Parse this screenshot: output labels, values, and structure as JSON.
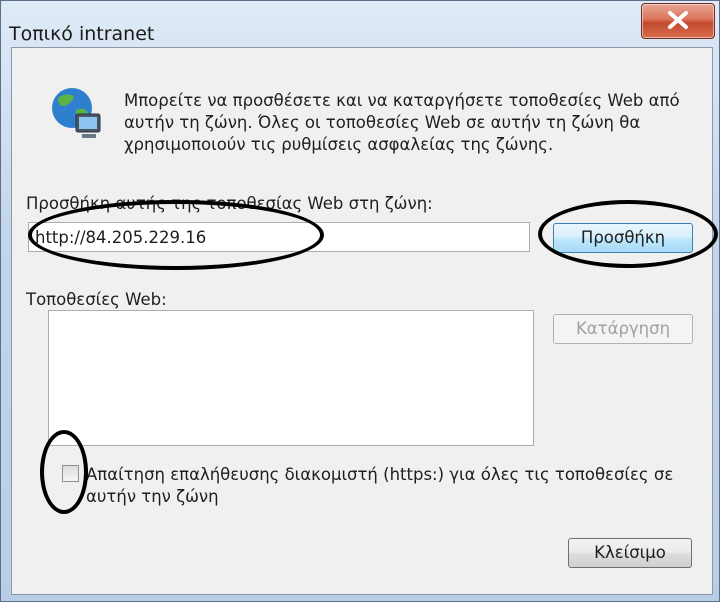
{
  "window": {
    "title": "Τοπικό intranet",
    "close_glyph": "X"
  },
  "intro_text": "Μπορείτε να προσθέσετε και να καταργήσετε τοποθεσίες Web από αυτήν τη ζώνη. Όλες οι τοποθεσίες Web σε αυτήν τη ζώνη θα χρησιμοποιούν τις ρυθμίσεις ασφαλείας της ζώνης.",
  "add_site": {
    "label": "Προσθήκη αυτής της τοποθεσίας Web στη ζώνη:",
    "value": "http://84.205.229.16",
    "button": "Προσθήκη"
  },
  "sites": {
    "label": "Τοποθεσίες Web:",
    "items": [],
    "remove_button": "Κατάργηση"
  },
  "require_https": {
    "label": "Απαίτηση επαλήθευσης διακομιστή (https:) για όλες τις τοποθεσίες σε αυτήν την ζώνη",
    "checked": false
  },
  "footer": {
    "close_button": "Κλείσιμο"
  },
  "icons": {
    "window_close": "close-icon",
    "globe": "globe-computer-icon"
  },
  "colors": {
    "annotation": "#000000",
    "close_button": "#c34a2c",
    "default_button": "#3c7fb1"
  }
}
